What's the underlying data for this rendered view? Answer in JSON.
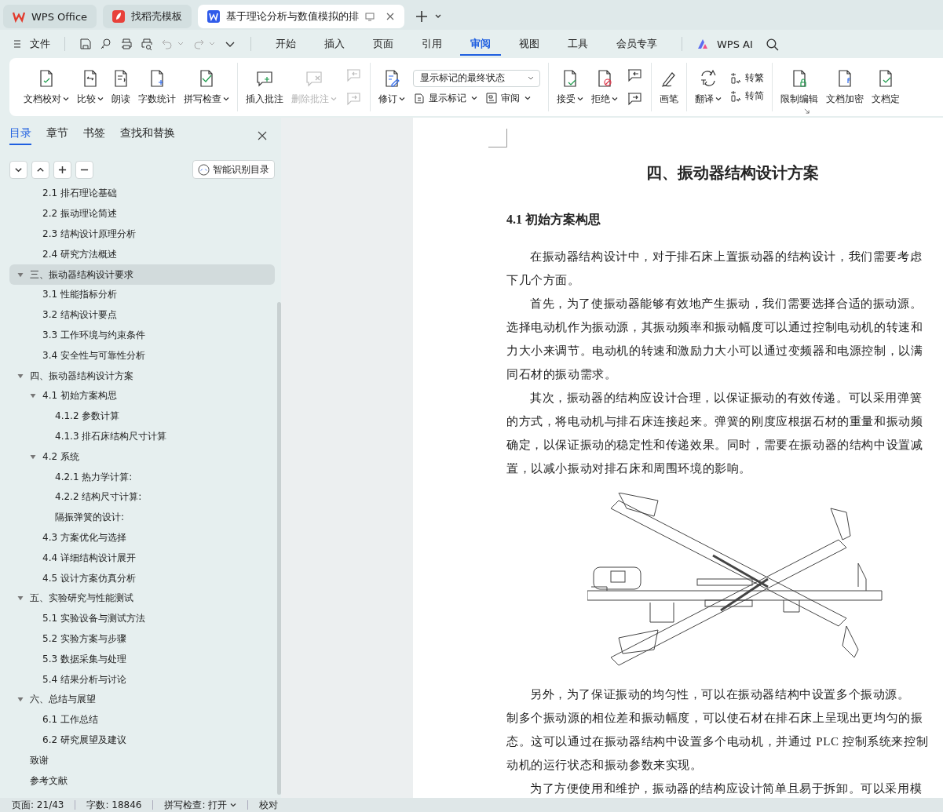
{
  "tabs": [
    {
      "label": "WPS Office",
      "kind": "home",
      "selected": false
    },
    {
      "label": "找稻壳模板",
      "kind": "template",
      "selected": false
    },
    {
      "label": "基于理论分析与数值模拟的排",
      "kind": "document",
      "selected": true
    }
  ],
  "menu": {
    "file": "文件",
    "tabs": [
      {
        "label": "开始",
        "selected": false
      },
      {
        "label": "插入",
        "selected": false
      },
      {
        "label": "页面",
        "selected": false
      },
      {
        "label": "引用",
        "selected": false
      },
      {
        "label": "审阅",
        "selected": true
      },
      {
        "label": "视图",
        "selected": false
      },
      {
        "label": "工具",
        "selected": false
      },
      {
        "label": "会员专享",
        "selected": false
      }
    ],
    "ai": "WPS AI"
  },
  "ribbon": {
    "groups": [
      {
        "items": [
          {
            "kind": "large",
            "label": "文档校对",
            "dropdown": true,
            "disabled": false
          },
          {
            "kind": "large",
            "label": "比较",
            "dropdown": true,
            "disabled": false
          },
          {
            "kind": "large",
            "label": "朗读",
            "dropdown": false,
            "disabled": false
          },
          {
            "kind": "large",
            "label": "字数统计",
            "dropdown": false,
            "disabled": false
          },
          {
            "kind": "large",
            "label": "拼写检查",
            "dropdown": true,
            "disabled": false
          }
        ]
      },
      {
        "items": [
          {
            "kind": "large",
            "label": "插入批注",
            "dropdown": false,
            "disabled": false
          },
          {
            "kind": "large",
            "label": "删除批注",
            "dropdown": true,
            "disabled": true
          },
          {
            "kind": "pair",
            "disabled": true
          }
        ]
      },
      {
        "items": [
          {
            "kind": "large",
            "label": "修订",
            "dropdown": true,
            "disabled": false
          },
          {
            "kind": "stack",
            "rows": [
              [
                {
                  "kind": "select",
                  "value": "显示标记的最终状态"
                }
              ],
              [
                {
                  "kind": "small",
                  "label": "显示标记",
                  "dropdown": true
                },
                {
                  "kind": "small",
                  "label": "审阅",
                  "dropdown": true
                }
              ]
            ]
          }
        ]
      },
      {
        "items": [
          {
            "kind": "large",
            "label": "接受",
            "dropdown": true,
            "disabled": false
          },
          {
            "kind": "large",
            "label": "拒绝",
            "dropdown": true,
            "disabled": false
          },
          {
            "kind": "pair",
            "disabled": false
          }
        ]
      },
      {
        "items": [
          {
            "kind": "large",
            "label": "画笔",
            "dropdown": false,
            "disabled": false
          }
        ]
      },
      {
        "items": [
          {
            "kind": "large",
            "label": "翻译",
            "dropdown": true,
            "disabled": false
          },
          {
            "kind": "stack",
            "rows": [
              [
                {
                  "kind": "small",
                  "label": "转繁",
                  "dropdown": false
                }
              ],
              [
                {
                  "kind": "small",
                  "label": "转简",
                  "dropdown": false
                }
              ]
            ]
          }
        ]
      },
      {
        "items": [
          {
            "kind": "large",
            "label": "限制编辑",
            "dropdown": false,
            "disabled": false
          },
          {
            "kind": "large",
            "label": "文档加密",
            "dropdown": false,
            "disabled": false
          },
          {
            "kind": "large",
            "label": "文档定",
            "dropdown": false,
            "disabled": false
          }
        ]
      }
    ]
  },
  "sidebar": {
    "tabs": [
      {
        "label": "目录",
        "selected": true
      },
      {
        "label": "章节",
        "selected": false
      },
      {
        "label": "书签",
        "selected": false
      },
      {
        "label": "查找和替换",
        "selected": false
      }
    ],
    "smart_button": "智能识别目录",
    "toc": {
      "continued": [
        {
          "label": "2.1 排石理论基础",
          "selected": false
        },
        {
          "label": "2.2 振动理论简述",
          "selected": false
        },
        {
          "label": "2.3 结构设计原理分析",
          "selected": false
        },
        {
          "label": "2.4 研究方法概述",
          "selected": false
        }
      ],
      "items": [
        {
          "label": "三、振动器结构设计要求",
          "selected": true,
          "expanded": true,
          "children": [
            {
              "label": "3.1 性能指标分析",
              "selected": false
            },
            {
              "label": "3.2 结构设计要点",
              "selected": false
            },
            {
              "label": "3.3 工作环境与约束条件",
              "selected": false
            },
            {
              "label": "3.4 安全性与可靠性分析",
              "selected": false
            }
          ]
        },
        {
          "label": "四、振动器结构设计方案",
          "selected": false,
          "expanded": true,
          "children": [
            {
              "label": "4.1 初始方案构思",
              "selected": false,
              "expanded": true,
              "children": [
                {
                  "label": "4.1.2 参数计算",
                  "selected": false
                },
                {
                  "label": "4.1.3 排石床结构尺寸计算",
                  "selected": false
                }
              ]
            },
            {
              "label": "4.2 系统",
              "selected": false,
              "expanded": true,
              "children": [
                {
                  "label": "4.2.1 热力学计算:",
                  "selected": false
                },
                {
                  "label": "4.2.2 结构尺寸计算:",
                  "selected": false
                },
                {
                  "label": "隔振弹簧的设计:",
                  "selected": false
                }
              ]
            },
            {
              "label": "4.3 方案优化与选择",
              "selected": false
            },
            {
              "label": "4.4 详细结构设计展开",
              "selected": false
            },
            {
              "label": "4.5 设计方案仿真分析",
              "selected": false
            }
          ]
        },
        {
          "label": "五、实验研究与性能测试",
          "selected": false,
          "expanded": true,
          "children": [
            {
              "label": "5.1 实验设备与测试方法",
              "selected": false
            },
            {
              "label": "5.2 实验方案与步骤",
              "selected": false
            },
            {
              "label": "5.3 数据采集与处理",
              "selected": false
            },
            {
              "label": "5.4 结果分析与讨论",
              "selected": false
            }
          ]
        },
        {
          "label": "六、总结与展望",
          "selected": false,
          "expanded": true,
          "children": [
            {
              "label": "6.1 工作总结",
              "selected": false
            },
            {
              "label": "6.2 研究展望及建议",
              "selected": false
            }
          ]
        },
        {
          "label": "致谢",
          "selected": false
        },
        {
          "label": "参考文献",
          "selected": false
        }
      ]
    }
  },
  "document": {
    "heading": "四、振动器结构设计方案",
    "subheading": "4.1 初始方案构思",
    "paragraphs_before": [
      {
        "lines": [
          "在振动器结构设计中，对于排石床上置振动器的结构设计，我们需要考虑",
          "下几个方面。"
        ]
      },
      {
        "lines": [
          "首先，为了使振动器能够有效地产生振动，我们需要选择合适的振动源。",
          "选择电动机作为振动源，其振动频率和振动幅度可以通过控制电动机的转速和",
          "力大小来调节。电动机的转速和激励力大小可以通过变频器和电源控制，以满",
          "同石材的振动需求。"
        ]
      },
      {
        "lines": [
          "其次，振动器的结构应设计合理，以保证振动的有效传递。可以采用弹簧",
          "的方式，将电动机与排石床连接起来。弹簧的刚度应根据石材的重量和振动频",
          "确定，以保证振动的稳定性和传递效果。同时，需要在振动器的结构中设置减",
          "置，以减小振动对排石床和周围环境的影响。"
        ]
      }
    ],
    "paragraphs_after": [
      {
        "lines": [
          "另外，为了保证振动的均匀性，可以在振动器结构中设置多个振动源。",
          "制多个振动源的相位差和振动幅度，可以使石材在排石床上呈现出更均匀的振",
          "态。这可以通过在振动器结构中设置多个电动机，并通过 PLC 控制系统来控制",
          "动机的运行状态和振动参数来实现。"
        ]
      },
      {
        "lines": [
          "为了方便使用和维护，振动器的结构应设计简单且易于拆卸。可以采用模"
        ]
      }
    ]
  },
  "status_bar": {
    "page": "页面: 21/43",
    "words": "字数: 18846",
    "spellcheck": "拼写检查: 打开",
    "proofread": "校对"
  }
}
